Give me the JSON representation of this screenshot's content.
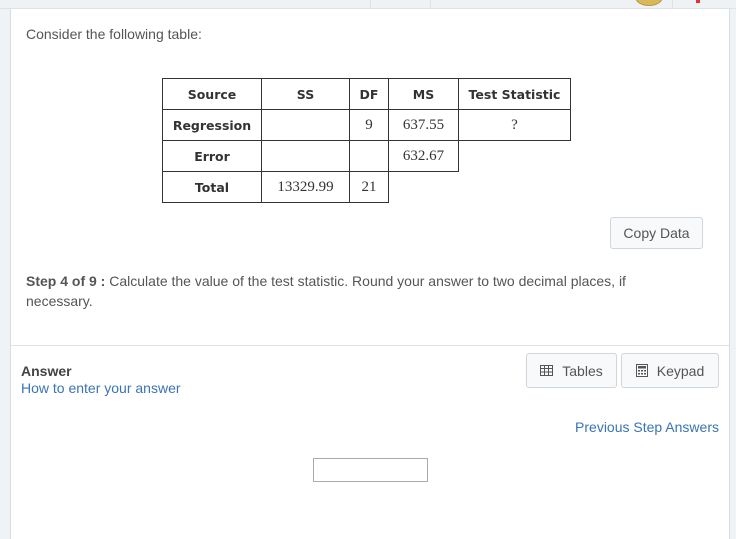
{
  "intro": "Consider the following table:",
  "table": {
    "headers": [
      "Source",
      "SS",
      "DF",
      "MS",
      "Test Statistic"
    ],
    "rows": [
      {
        "source": "Regression",
        "ss": "",
        "df": "9",
        "ms": "637.55",
        "test_statistic": "?"
      },
      {
        "source": "Error",
        "ss": "",
        "df": "",
        "ms": "632.67"
      },
      {
        "source": "Total",
        "ss": "13329.99",
        "df": "21"
      }
    ]
  },
  "copy_data_label": "Copy Data",
  "step": {
    "label": "Step 4 of 9 :",
    "text": " Calculate the value of the test statistic. Round your answer to two decimal places, if necessary."
  },
  "answer": {
    "label": "Answer",
    "how_to_link": "How to enter your answer",
    "input_value": ""
  },
  "tools": {
    "tables_label": "Tables",
    "tables_icon": "table-grid-icon",
    "keypad_label": "Keypad",
    "keypad_icon": "calculator-icon"
  },
  "previous_step_answers": "Previous Step Answers"
}
